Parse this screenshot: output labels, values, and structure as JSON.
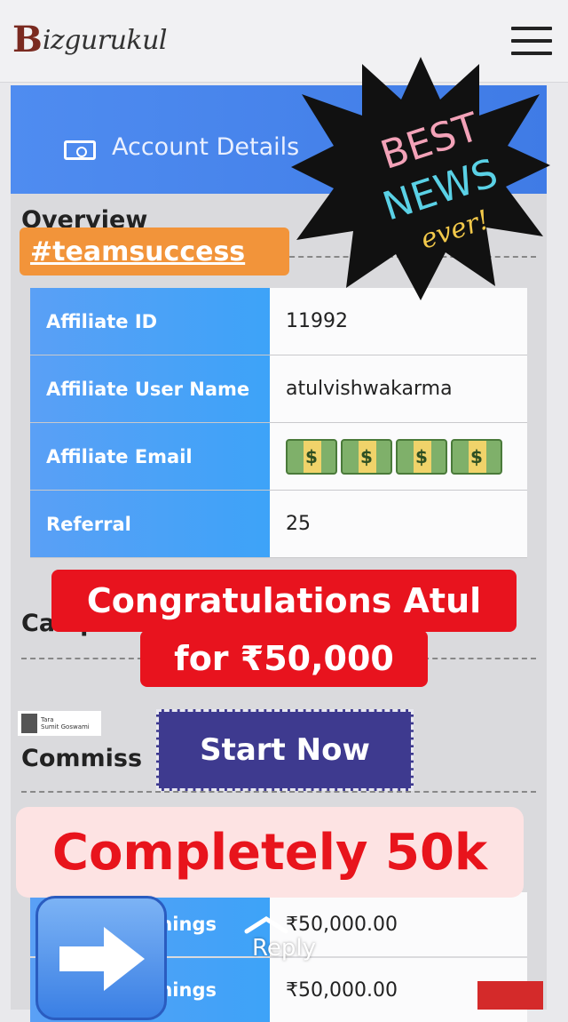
{
  "header": {
    "logo_b": "B",
    "logo_rest": "izgurukul"
  },
  "tabs": {
    "account_label": "Account Details"
  },
  "sections": {
    "overview": "Overview",
    "campaigns_partial": "Campai",
    "commission_partial": "Commiss"
  },
  "affiliate_table": {
    "rows": [
      {
        "label": "Affiliate ID",
        "value": "11992"
      },
      {
        "label": "Affiliate User Name",
        "value": "atulvishwakarma"
      },
      {
        "label": "Affiliate Email",
        "value": ""
      },
      {
        "label": "Referral",
        "value": "25"
      }
    ]
  },
  "earnings": {
    "rows": [
      {
        "label_partial": "nings",
        "value": "₹50,000.00"
      },
      {
        "label_partial": "nings",
        "value": "₹50,000.00"
      }
    ]
  },
  "overlays": {
    "hashtag": "#teamsuccess",
    "sticker_line1": "BEST",
    "sticker_line2": "NEWS",
    "sticker_line3": "ever!",
    "congrats_line1": "Congratulations Atul",
    "congrats_line2": "for ₹50,000",
    "start_button": "Start Now",
    "completely": "Completely 50k",
    "reply": "Reply",
    "credit_title": "Tara",
    "credit_name": "Sumit Goswami"
  },
  "colors": {
    "accent_blue": "#4f8cf0",
    "table_header_blue": "#3da3f8",
    "alert_red": "#e8131e",
    "tag_orange": "#f2943a",
    "start_purple": "#3e3a8f"
  },
  "icons": {
    "menu": "hamburger-icon",
    "account": "money-card-icon",
    "money": "money-bag-icon",
    "arrow": "right-arrow-icon"
  }
}
